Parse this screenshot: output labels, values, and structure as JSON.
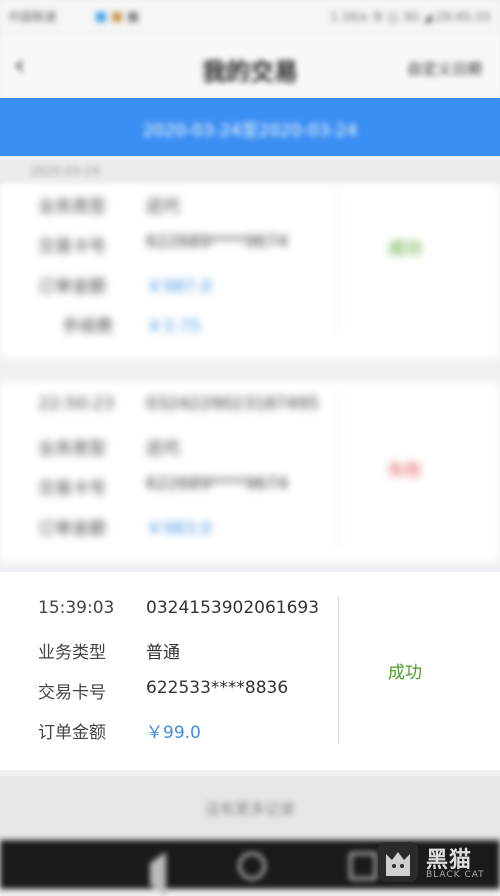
{
  "status_bar": {
    "left_text": "中国联通",
    "right_text": "1.1K/s 令 ◫ 3G ◢ 20:45:33"
  },
  "header": {
    "back_icon": "chevron-left",
    "title": "我的交易",
    "right_action": "自定义日期"
  },
  "date_range": "2020-03-24至2020-03-24",
  "section_date": "2020-03-24",
  "cards": [
    {
      "rows": [
        {
          "label": "业务类型",
          "value": "还代",
          "money": false
        },
        {
          "label": "交易卡号",
          "value": "622689****9674",
          "money": false
        },
        {
          "label": "订单金额",
          "value": "￥987.0",
          "money": true
        },
        {
          "label": "手续费",
          "value": "￥3.75",
          "money": true
        }
      ],
      "status": "成功",
      "status_kind": "success"
    },
    {
      "rows": [
        {
          "label": "22:50:23",
          "value": "0324229023187495",
          "money": false
        },
        {
          "label": "业务类型",
          "value": "还代",
          "money": false
        },
        {
          "label": "交易卡号",
          "value": "622689****9674",
          "money": false
        },
        {
          "label": "订单金额",
          "value": "￥983.0",
          "money": true
        }
      ],
      "status": "失败",
      "status_kind": "failure"
    },
    {
      "rows": [
        {
          "label": "15:39:03",
          "value": "0324153902061693",
          "money": false
        },
        {
          "label": "业务类型",
          "value": "普通",
          "money": false
        },
        {
          "label": "交易卡号",
          "value": "622533****8836",
          "money": false
        },
        {
          "label": "订单金额",
          "value": "￥99.0",
          "money": true
        }
      ],
      "status": "成功",
      "status_kind": "success"
    }
  ],
  "bottom_button": "没有更多记录",
  "system_nav": [
    "back-icon",
    "home-icon",
    "recents-icon"
  ],
  "watermark": {
    "text_cn": "黑猫",
    "text_en": "BLACK CAT"
  },
  "colors": {
    "accent": "#3b8ff2",
    "success": "#4a9d25",
    "failure": "#e05252",
    "money": "#3e8de0"
  }
}
